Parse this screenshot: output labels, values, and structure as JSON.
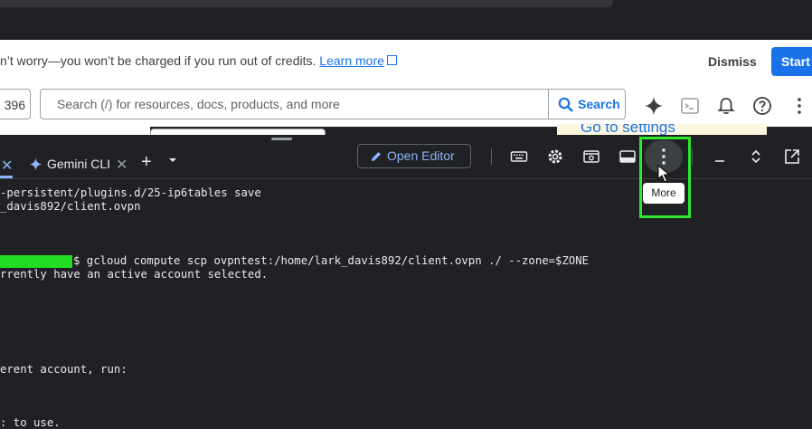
{
  "banner": {
    "message": "n’t worry—you won’t be charged if you run out of credits.",
    "learn_more": "Learn more",
    "dismiss": "Dismiss",
    "start": "Start"
  },
  "header": {
    "project_fragment": "396",
    "search_placeholder": "Search (/) for resources, docs, products, and more",
    "search_button": "Search"
  },
  "behind": {
    "go_to_settings": "Go to settings"
  },
  "terminal_header": {
    "tab_label": "Gemini CLI",
    "open_editor": "Open Editor",
    "more_tooltip": "More"
  },
  "colors": {
    "highlight": "#2ee82e",
    "accent": "#1a73e8",
    "terminal_bg": "#202124"
  },
  "terminal": {
    "lines": [
      "-persistent/plugins.d/25-ip6tables save",
      "_davis892/client.ovpn",
      "$ gcloud compute scp ovpntest:/home/lark_davis892/client.ovpn ./ --zone=$ZONE",
      "rrently have an active account selected.",
      "erent account, run:",
      ": to use."
    ]
  }
}
